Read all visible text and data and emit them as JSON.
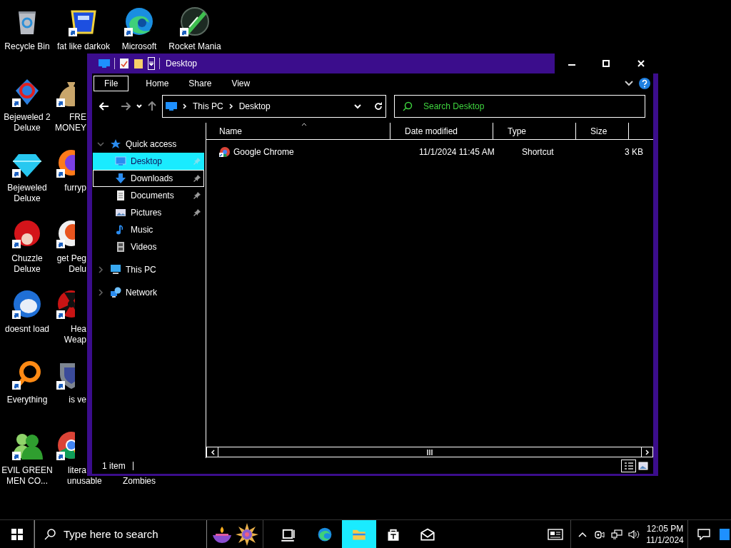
{
  "desktop": {
    "columns": [
      [
        {
          "kind": "bin",
          "shortcut": false,
          "label": "Recycle Bin"
        },
        {
          "kind": "gem2",
          "shortcut": true,
          "label": "Bejeweled 2 Deluxe"
        },
        {
          "kind": "gem",
          "shortcut": true,
          "label": "Bejeweled Deluxe"
        },
        {
          "kind": "fuzz",
          "shortcut": true,
          "label": "Chuzzle Deluxe"
        },
        {
          "kind": "bird",
          "shortcut": true,
          "label": "doesnt load"
        },
        {
          "kind": "ring",
          "shortcut": true,
          "label": "Everything"
        },
        {
          "kind": "people",
          "shortcut": true,
          "label": "EVIL GREEN MEN CO..."
        }
      ],
      [
        {
          "kind": "emblem",
          "shortcut": true,
          "label": "fat like darkok"
        },
        {
          "kind": "bag",
          "shortcut": true,
          "lines": [
            "FRE",
            "MONEY"
          ]
        },
        {
          "kind": "fox",
          "shortcut": true,
          "lines": [
            "furryp"
          ]
        },
        {
          "kind": "peg",
          "shortcut": true,
          "lines": [
            "get Peg",
            "Delu"
          ]
        },
        {
          "kind": "hazard",
          "shortcut": true,
          "lines": [
            "Hea",
            "Weap"
          ]
        },
        {
          "kind": "shield",
          "shortcut": true,
          "lines": [
            "is ve"
          ]
        },
        {
          "kind": "chrome",
          "shortcut": true,
          "lines": [
            "litera",
            "unusable"
          ]
        }
      ],
      [
        {
          "kind": "swirl",
          "shortcut": true,
          "label": "Microsoft"
        },
        null,
        null,
        null,
        null,
        null,
        {
          "label": "Zombies"
        }
      ],
      [
        {
          "kind": "rocket",
          "shortcut": true,
          "label": "Rocket Mania"
        }
      ]
    ]
  },
  "window": {
    "title": "Desktop",
    "ribbon": [
      {
        "kind": "menu",
        "label": "File"
      },
      {
        "kind": "tab",
        "label": "Home"
      },
      {
        "kind": "tab",
        "label": "Share"
      },
      {
        "kind": "tab",
        "label": "View"
      }
    ],
    "address": [
      "This PC",
      "Desktop"
    ],
    "search": {
      "placeholder": "Search Desktop"
    },
    "nav": [
      {
        "label": "Quick access",
        "kind": "star",
        "expanded": true,
        "children": [
          {
            "label": "Desktop",
            "kind": "desktop",
            "selected": true,
            "hovered": false,
            "pinned": true
          },
          {
            "label": "Downloads",
            "kind": "download",
            "selected": false,
            "hovered": true,
            "pinned": true
          },
          {
            "label": "Documents",
            "kind": "document",
            "selected": false,
            "hovered": false,
            "pinned": true
          },
          {
            "label": "Pictures",
            "kind": "picture",
            "selected": false,
            "hovered": false,
            "pinned": true
          },
          {
            "label": "Music",
            "kind": "music",
            "selected": false,
            "hovered": false,
            "pinned": false
          },
          {
            "label": "Videos",
            "kind": "video",
            "selected": false,
            "hovered": false,
            "pinned": false
          }
        ]
      },
      {
        "label": "This PC",
        "kind": "pc",
        "expanded": false
      },
      {
        "label": "Network",
        "kind": "network",
        "expanded": false
      }
    ],
    "columns": [
      {
        "label": "Name",
        "sorted": true
      },
      {
        "label": "Date modified",
        "sorted": false
      },
      {
        "label": "Type",
        "sorted": false
      },
      {
        "label": "Size",
        "sorted": false
      }
    ],
    "rows": [
      {
        "name": "Google Chrome",
        "date": "11/1/2024 11:45 AM",
        "type": "Shortcut",
        "size": "3 KB"
      }
    ],
    "status": "1 item"
  },
  "taskbar": {
    "search": {
      "placeholder": "Type here to search"
    },
    "apps": [
      {
        "kind": "task-view",
        "selected": false
      },
      {
        "kind": "swirl",
        "selected": false
      },
      {
        "kind": "folder",
        "selected": true
      },
      {
        "kind": "store",
        "selected": false
      },
      {
        "kind": "mail",
        "selected": false
      }
    ],
    "time": "12:05 PM",
    "date": "11/1/2024"
  }
}
